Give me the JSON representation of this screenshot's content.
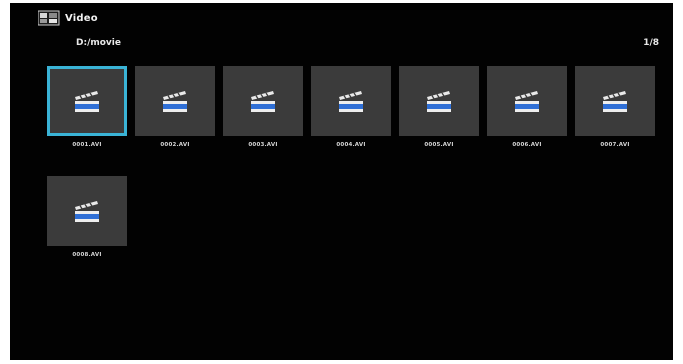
{
  "header": {
    "app_icon": "video-folder-icon",
    "title": "Video"
  },
  "location": {
    "path": "D:/movie",
    "page": "1/8"
  },
  "files": [
    {
      "name": "0001.AVI",
      "icon": "clapperboard-icon",
      "selected": true
    },
    {
      "name": "0002.AVI",
      "icon": "clapperboard-icon",
      "selected": false
    },
    {
      "name": "0003.AVI",
      "icon": "clapperboard-icon",
      "selected": false
    },
    {
      "name": "0004.AVI",
      "icon": "clapperboard-icon",
      "selected": false
    },
    {
      "name": "0005.AVI",
      "icon": "clapperboard-icon",
      "selected": false
    },
    {
      "name": "0006.AVI",
      "icon": "clapperboard-icon",
      "selected": false
    },
    {
      "name": "0007.AVI",
      "icon": "clapperboard-icon",
      "selected": false
    },
    {
      "name": "0008.AVI",
      "icon": "clapperboard-icon",
      "selected": false
    }
  ],
  "colors": {
    "background": "#020202",
    "tile": "#3b3b3b",
    "selection": "#3ab3d6",
    "icon_blue": "#2f6fd6"
  }
}
